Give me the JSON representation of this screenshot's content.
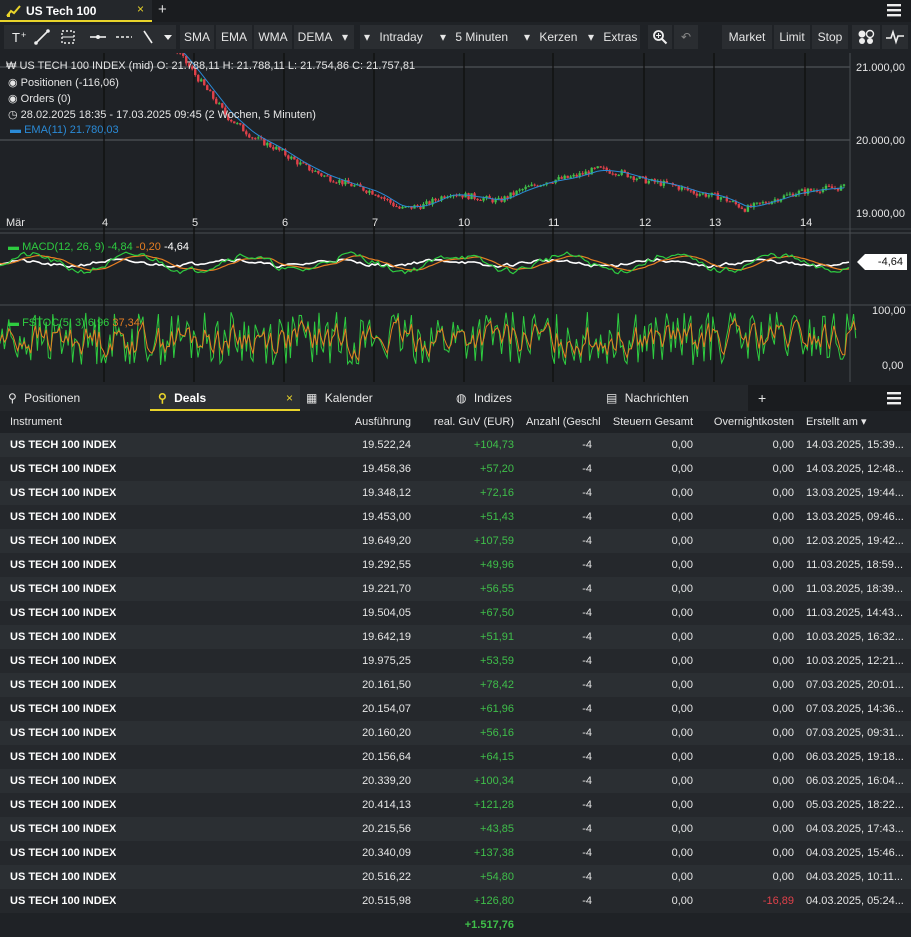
{
  "app": {
    "tab_title": "US Tech 100",
    "tab_close": "×",
    "tab_add": "+"
  },
  "toolbar": {
    "indicators": [
      "SMA",
      "EMA",
      "WMA",
      "DEMA"
    ],
    "interval_mode": "Intraday",
    "interval": "5 Minuten",
    "chart_type": "Kerzen",
    "extras": "Extras",
    "orders": [
      "Market",
      "Limit",
      "Stop"
    ]
  },
  "chart": {
    "ohlc_label": "US TECH 100 INDEX (mid)  O: 21.788,11  H: 21.788,11  L: 21.754,86  C: 21.757,81",
    "positions": "Positionen (-116,06)",
    "orders": "Orders (0)",
    "range": "28.02.2025 18:35 - 17.03.2025 09:45  (2 Wochen, 5 Minuten)",
    "ema": "EMA(11)  21.780,03",
    "y_labels": [
      "21.000,00",
      "20.000,00",
      "19.000,00"
    ],
    "x_labels": [
      "Mär",
      "4",
      "5",
      "6",
      "7",
      "10",
      "11",
      "12",
      "13",
      "14"
    ],
    "macd": {
      "name": "MACD(12, 26, 9)",
      "v1": "-4,84",
      "v2": "-0,20",
      "v3": "-4,64",
      "badge": "-4,64"
    },
    "fstoc": {
      "name": "FSTOC(5, 3)",
      "v1": "6,96",
      "v2": "37,34",
      "top": "100,00",
      "bottom": "0,00"
    },
    "colors": {
      "up": "#3fbf4a",
      "down": "#e0414a",
      "ema": "#2a8ad6",
      "macd": "#2ecc40",
      "signal": "#e67e22",
      "hist": "#ffffff"
    }
  },
  "tabs": {
    "positionen": "Positionen",
    "deals": "Deals",
    "kalender": "Kalender",
    "indizes": "Indizes",
    "nachrichten": "Nachrichten",
    "add": "+"
  },
  "table": {
    "headers": [
      "Instrument",
      "Ausführung",
      "real. GuV (EUR)",
      "Anzahl (Geschl",
      "Steuern Gesamt",
      "Overnightkosten",
      "Erstellt am"
    ],
    "rows": [
      [
        "US TECH 100 INDEX",
        "19.522,24",
        "+104,73",
        "-4",
        "0,00",
        "0,00",
        "14.03.2025, 15:39..."
      ],
      [
        "US TECH 100 INDEX",
        "19.458,36",
        "+57,20",
        "-4",
        "0,00",
        "0,00",
        "14.03.2025, 12:48..."
      ],
      [
        "US TECH 100 INDEX",
        "19.348,12",
        "+72,16",
        "-4",
        "0,00",
        "0,00",
        "13.03.2025, 19:44..."
      ],
      [
        "US TECH 100 INDEX",
        "19.453,00",
        "+51,43",
        "-4",
        "0,00",
        "0,00",
        "13.03.2025, 09:46..."
      ],
      [
        "US TECH 100 INDEX",
        "19.649,20",
        "+107,59",
        "-4",
        "0,00",
        "0,00",
        "12.03.2025, 19:42..."
      ],
      [
        "US TECH 100 INDEX",
        "19.292,55",
        "+49,96",
        "-4",
        "0,00",
        "0,00",
        "11.03.2025, 18:59..."
      ],
      [
        "US TECH 100 INDEX",
        "19.221,70",
        "+56,55",
        "-4",
        "0,00",
        "0,00",
        "11.03.2025, 18:39..."
      ],
      [
        "US TECH 100 INDEX",
        "19.504,05",
        "+67,50",
        "-4",
        "0,00",
        "0,00",
        "11.03.2025, 14:43..."
      ],
      [
        "US TECH 100 INDEX",
        "19.642,19",
        "+51,91",
        "-4",
        "0,00",
        "0,00",
        "10.03.2025, 16:32..."
      ],
      [
        "US TECH 100 INDEX",
        "19.975,25",
        "+53,59",
        "-4",
        "0,00",
        "0,00",
        "10.03.2025, 12:21..."
      ],
      [
        "US TECH 100 INDEX",
        "20.161,50",
        "+78,42",
        "-4",
        "0,00",
        "0,00",
        "07.03.2025, 20:01..."
      ],
      [
        "US TECH 100 INDEX",
        "20.154,07",
        "+61,96",
        "-4",
        "0,00",
        "0,00",
        "07.03.2025, 14:36..."
      ],
      [
        "US TECH 100 INDEX",
        "20.160,20",
        "+56,16",
        "-4",
        "0,00",
        "0,00",
        "07.03.2025, 09:31..."
      ],
      [
        "US TECH 100 INDEX",
        "20.156,64",
        "+64,15",
        "-4",
        "0,00",
        "0,00",
        "06.03.2025, 19:18..."
      ],
      [
        "US TECH 100 INDEX",
        "20.339,20",
        "+100,34",
        "-4",
        "0,00",
        "0,00",
        "06.03.2025, 16:04..."
      ],
      [
        "US TECH 100 INDEX",
        "20.414,13",
        "+121,28",
        "-4",
        "0,00",
        "0,00",
        "05.03.2025, 18:22..."
      ],
      [
        "US TECH 100 INDEX",
        "20.215,56",
        "+43,85",
        "-4",
        "0,00",
        "0,00",
        "04.03.2025, 17:43..."
      ],
      [
        "US TECH 100 INDEX",
        "20.340,09",
        "+137,38",
        "-4",
        "0,00",
        "0,00",
        "04.03.2025, 15:46..."
      ],
      [
        "US TECH 100 INDEX",
        "20.516,22",
        "+54,80",
        "-4",
        "0,00",
        "0,00",
        "04.03.2025, 10:11..."
      ],
      [
        "US TECH 100 INDEX",
        "20.515,98",
        "+126,80",
        "-4",
        "0,00",
        "-16,89",
        "04.03.2025, 05:24..."
      ]
    ],
    "total": "+1.517,76"
  },
  "chart_data": {
    "type": "line",
    "series": [
      {
        "values": [
          21500,
          21450,
          21300,
          21150,
          21300,
          21500,
          21350,
          21100,
          20700,
          20300,
          20050,
          19900,
          19700,
          19550,
          19450,
          19350,
          19150,
          19200,
          19350,
          19300,
          19250,
          19400,
          19500,
          19550,
          19650,
          19600,
          19500,
          19450,
          19350,
          19300,
          19150,
          19250,
          19350,
          19400,
          19420
        ]
      }
    ],
    "ylim": [
      18900,
      21100
    ],
    "y_ticks": [
      "21.000,00",
      "20.000,00",
      "19.000,00"
    ],
    "x_ticks": [
      "Mär",
      "4",
      "5",
      "6",
      "7",
      "10",
      "11",
      "12",
      "13",
      "14"
    ]
  }
}
